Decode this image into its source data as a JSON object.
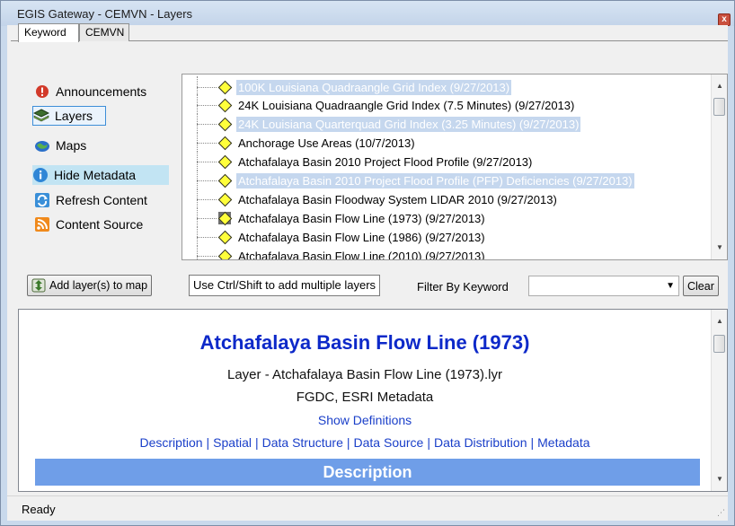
{
  "window": {
    "title": "EGIS Gateway - CEMVN - Layers",
    "close_glyph": "x"
  },
  "tabs": [
    {
      "label": "Keyword",
      "active": true
    },
    {
      "label": "CEMVN",
      "active": false
    }
  ],
  "nav": {
    "announcements": "Announcements",
    "layers": "Layers",
    "maps": "Maps",
    "hide_metadata": "Hide Metadata",
    "refresh_content": "Refresh Content",
    "content_source": "Content Source"
  },
  "layers": [
    {
      "label": "100K Louisiana Quadraangle Grid Index (9/27/2013)",
      "selected": true
    },
    {
      "label": "24K Louisiana Quadraangle Grid Index (7.5 Minutes) (9/27/2013)",
      "selected": false
    },
    {
      "label": "24K Louisiana Quarterquad Grid Index (3.25 Minutes) (9/27/2013)",
      "selected": true
    },
    {
      "label": "Anchorage Use Areas (10/7/2013)",
      "selected": false
    },
    {
      "label": "Atchafalaya Basin 2010 Project Flood Profile (9/27/2013)",
      "selected": false
    },
    {
      "label": "Atchafalaya Basin 2010 Project Flood Profile (PFP) Deficiencies (9/27/2013)",
      "selected": true
    },
    {
      "label": "Atchafalaya Basin Floodway System LIDAR 2010 (9/27/2013)",
      "selected": false
    },
    {
      "label": "Atchafalaya Basin Flow Line (1973) (9/27/2013)",
      "selected": false,
      "focused": true
    },
    {
      "label": "Atchafalaya Basin Flow Line (1986) (9/27/2013)",
      "selected": false
    },
    {
      "label": "Atchafalaya Basin Flow Line (2010) (9/27/2013)",
      "selected": false
    }
  ],
  "toolbar": {
    "add_layers": "Add layer(s) to map",
    "hint": "Use Ctrl/Shift to add multiple layers",
    "filter_label": "Filter By Keyword",
    "filter_value": "",
    "clear": "Clear"
  },
  "metadata": {
    "title": "Atchafalaya Basin Flow Line (1973)",
    "layer_file": "Layer - Atchafalaya Basin Flow Line (1973).lyr",
    "formats": "FGDC, ESRI Metadata",
    "show_definitions": "Show Definitions",
    "links": [
      "Description",
      "Spatial",
      "Data Structure",
      "Data Source",
      "Data Distribution",
      "Metadata"
    ],
    "section_header": "Description"
  },
  "status": {
    "text": "Ready"
  },
  "colors": {
    "accent": "#6f9ee8",
    "link": "#1a3fc9",
    "title": "#0d29c9",
    "selection": "#c5d7ee"
  }
}
